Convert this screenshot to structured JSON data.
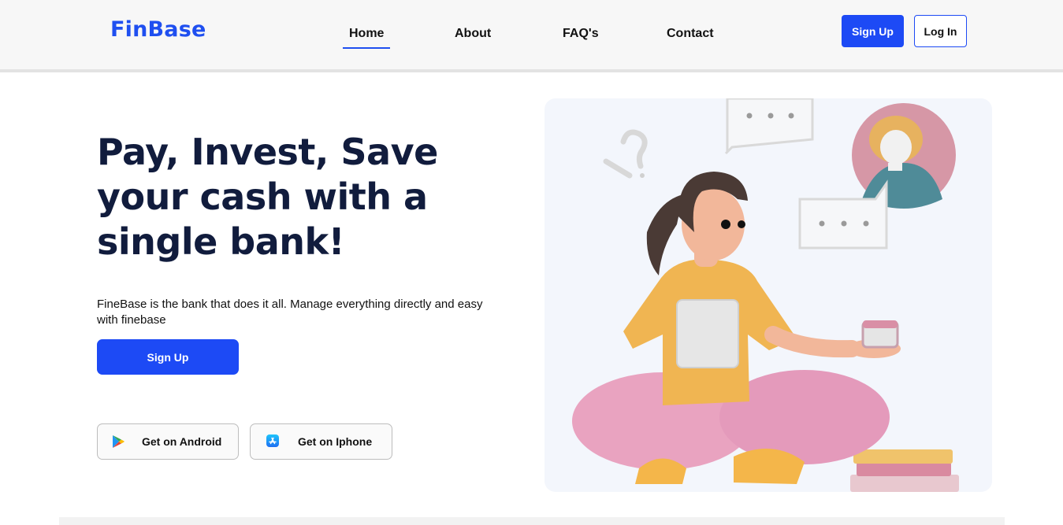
{
  "brand": {
    "name": "FinBase"
  },
  "nav": {
    "items": [
      {
        "label": "Home",
        "active": true
      },
      {
        "label": "About",
        "active": false
      },
      {
        "label": "FAQ's",
        "active": false
      },
      {
        "label": "Contact",
        "active": false
      }
    ]
  },
  "header_actions": {
    "signup_label": "Sign Up",
    "login_label": "Log In"
  },
  "hero": {
    "title_line1": "Pay, Invest, Save",
    "title_line2": "your cash with a",
    "title_line3": "single bank!",
    "subtitle": "FineBase is the bank that does it all. Manage everything directly and easy with finebase",
    "signup_label": "Sign Up",
    "android_label": "Get on Android",
    "iphone_label": "Get on Iphone"
  },
  "icons": {
    "android": "google-play-icon",
    "iphone": "app-store-icon"
  },
  "colors": {
    "accent": "#1d4af5",
    "title": "#111c3d",
    "illustration_bg": "#f3f6fc"
  }
}
